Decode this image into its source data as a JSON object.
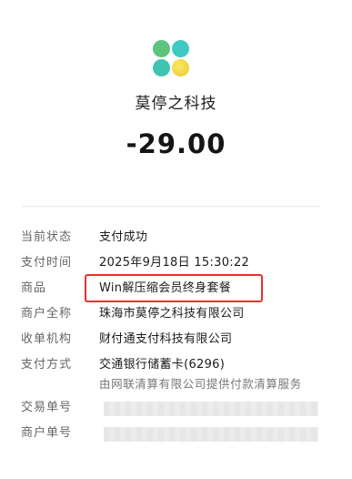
{
  "merchant": {
    "name": "莫停之科技"
  },
  "amount": "-29.00",
  "colors": {
    "logo_teal": "#3ec9c5",
    "logo_green": "#6dc87a",
    "logo_yellow": "#f2d949",
    "highlight": "#e53030"
  },
  "details": {
    "status": {
      "label": "当前状态",
      "value": "支付成功"
    },
    "pay_time": {
      "label": "支付时间",
      "value": "2025年9月18日 15:30:22"
    },
    "goods": {
      "label": "商品",
      "value": "Win解压缩会员终身套餐"
    },
    "merchant_full": {
      "label": "商户全称",
      "value": "珠海市莫停之科技有限公司"
    },
    "acquirer": {
      "label": "收单机构",
      "value": "财付通支付科技有限公司"
    },
    "pay_method": {
      "label": "支付方式",
      "value": "交通银行储蓄卡(6296)"
    },
    "clearing_note": {
      "value": "由网联清算有限公司提供付款清算服务"
    },
    "txn_no": {
      "label": "交易单号"
    },
    "merchant_no": {
      "label": "商户单号"
    }
  }
}
